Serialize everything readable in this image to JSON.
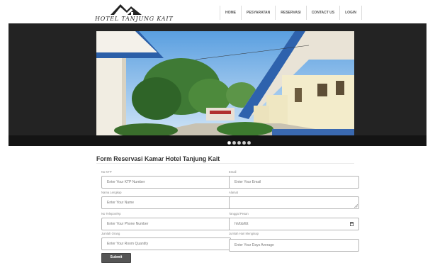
{
  "brand": {
    "name": "HOTEL TANJUNG KAIT"
  },
  "nav": {
    "items": [
      {
        "label": "HOME"
      },
      {
        "label": "PESYARATAN"
      },
      {
        "label": "RESERVASI"
      },
      {
        "label": "CONTACT US"
      },
      {
        "label": "LOGIN"
      }
    ]
  },
  "slider": {
    "dot_count": 5,
    "active_index": 0
  },
  "form": {
    "title": "Form Reservasi Kamar Hotel Tanjung Kait",
    "fields": {
      "ktp": {
        "label": "No KTP",
        "placeholder": "Enter Your KTP Number"
      },
      "email": {
        "label": "Email",
        "placeholder": "Enter Your Email"
      },
      "name": {
        "label": "Nama Lengkap",
        "placeholder": "Enter Your Name"
      },
      "address": {
        "label": "Alamat",
        "placeholder": ""
      },
      "phone": {
        "label": "No Telepon/Hp",
        "placeholder": "Enter Your Phone Number"
      },
      "date": {
        "label": "Tanggal Pesan",
        "placeholder": "hh/bb/tttt"
      },
      "quantity": {
        "label": "Jumlah Orang",
        "placeholder": "Enter Your Room Quantity"
      },
      "days": {
        "label": "Jumlah Hari Menginap",
        "placeholder": "Enter Your Days Average"
      }
    },
    "submit_label": "Submit"
  },
  "colors": {
    "hero_bg": "#232323",
    "submit_bg": "#555555",
    "input_border": "#b5b5b5"
  }
}
